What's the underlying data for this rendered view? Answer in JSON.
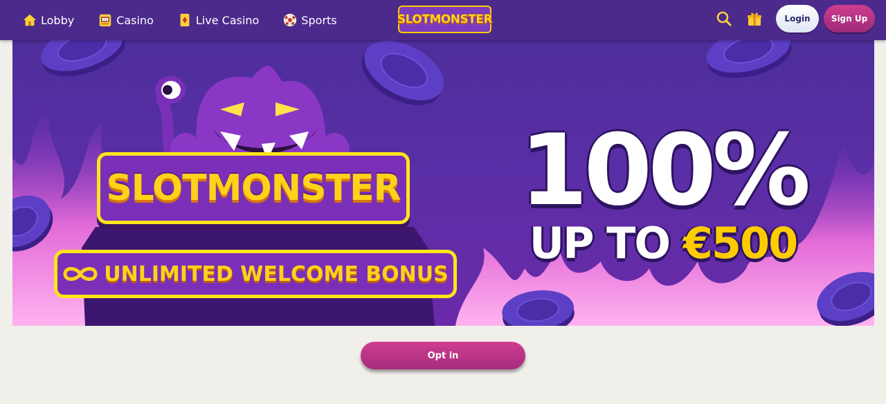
{
  "nav": {
    "items": [
      {
        "label": "Lobby",
        "icon": "home-icon"
      },
      {
        "label": "Casino",
        "icon": "slot-machine-icon"
      },
      {
        "label": "Live Casino",
        "icon": "playing-card-icon"
      },
      {
        "label": "Sports",
        "icon": "soccer-ball-icon"
      }
    ]
  },
  "brand": {
    "name": "SlotMonster"
  },
  "header": {
    "login_label": "Login",
    "signup_label": "Sign Up",
    "icons": [
      "search-icon",
      "gift-icon"
    ]
  },
  "banner": {
    "logo_text": "SlotMonster",
    "pill_text": "UNLIMITED WELCOME BONUS",
    "headline": "100%",
    "sub_prefix": "UP TO ",
    "sub_amount": "€500"
  },
  "optin": {
    "label": "Opt in"
  },
  "colors": {
    "header_bg": "#4b2a8c",
    "banner_bg": "#5a2ea6",
    "accent_pink": "#b8327f",
    "accent_yellow": "#ffcc00",
    "page_bg": "#f0efea"
  }
}
